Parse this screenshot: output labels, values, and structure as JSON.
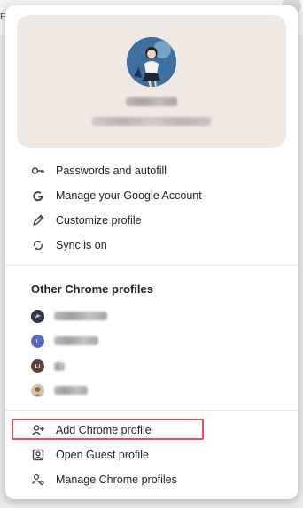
{
  "menu": {
    "actions": [
      {
        "label": "Passwords and autofill",
        "icon": "key-icon"
      },
      {
        "label": "Manage your Google Account",
        "icon": "google-g-icon"
      },
      {
        "label": "Customize profile",
        "icon": "pencil-icon"
      },
      {
        "label": "Sync is on",
        "icon": "sync-icon"
      }
    ],
    "other_profiles_title": "Other Chrome profiles",
    "other_profiles": [
      {
        "initial": "",
        "color": "#2c3e50"
      },
      {
        "initial": "L",
        "color": "#5c6bc0"
      },
      {
        "initial": "LI",
        "color": "#5d4037"
      },
      {
        "initial": "",
        "color": "#b0a090"
      }
    ],
    "footer_actions": [
      {
        "label": "Add Chrome profile",
        "icon": "add-person-icon"
      },
      {
        "label": "Open Guest profile",
        "icon": "guest-icon"
      },
      {
        "label": "Manage Chrome profiles",
        "icon": "manage-profiles-icon"
      }
    ]
  },
  "colors": {
    "card_background": "#f0e8e3",
    "highlight_border": "#e0525a"
  }
}
